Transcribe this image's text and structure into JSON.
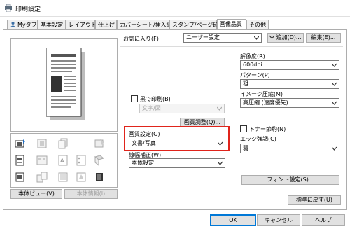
{
  "window": {
    "title": "印刷設定"
  },
  "tabs": [
    {
      "label": "Myタブ"
    },
    {
      "label": "基本設定"
    },
    {
      "label": "レイアウト"
    },
    {
      "label": "仕上げ"
    },
    {
      "label": "カバーシート/挿入紙"
    },
    {
      "label": "スタンプ/ページ印字"
    },
    {
      "label": "画像品質"
    },
    {
      "label": "その他"
    }
  ],
  "active_tab": "画像品質",
  "favorites": {
    "label": "お気に入り(F)",
    "value": "ユーザー設定",
    "add_button": "追加(D)...",
    "edit_button": "編集(E)..."
  },
  "left": {
    "preview_button": "本体ビュー(V)",
    "info_button": "本体情報(I)"
  },
  "middle": {
    "black_print_label": "黒で印刷(B)",
    "black_print_value": "文字/図",
    "image_adjust_button": "画質調整(Q)...",
    "quality_label": "画質設定(G)",
    "quality_value": "文書/写真",
    "line_label": "線幅補正(W)",
    "line_value": "本体設定"
  },
  "right": {
    "resolution_label": "解像度(R)",
    "resolution_value": "600dpi",
    "pattern_label": "パターン(P)",
    "pattern_value": "粗",
    "compression_label": "イメージ圧縮(M)",
    "compression_value": "高圧縮 (速度優先)",
    "toner_save_label": "トナー節約(N)",
    "edge_label": "エッジ強調(C)",
    "edge_value": "弱",
    "font_button": "フォント設定(S)..."
  },
  "reset_button": "標準に戻す(U)",
  "footer": {
    "ok": "OK",
    "cancel": "キャンセル",
    "help": "ヘルプ"
  },
  "colors": {
    "highlight": "#e0241b",
    "ok_border": "#0078d7"
  }
}
